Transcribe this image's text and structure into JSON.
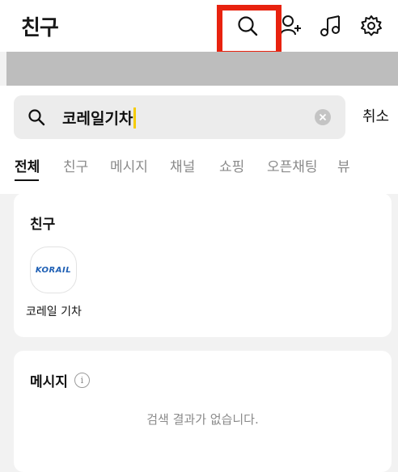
{
  "header": {
    "title": "친구",
    "icons": [
      "search-icon",
      "add-friend-icon",
      "music-icon",
      "gear-icon"
    ]
  },
  "search": {
    "value": "코레일기차",
    "cancel_label": "취소"
  },
  "tabs": [
    {
      "label": "전체",
      "active": true
    },
    {
      "label": "친구",
      "active": false
    },
    {
      "label": "메시지",
      "active": false
    },
    {
      "label": "채널",
      "active": false
    },
    {
      "label": "쇼핑",
      "active": false
    },
    {
      "label": "오픈채팅",
      "active": false
    },
    {
      "label": "뷰",
      "active": false
    }
  ],
  "friends_section": {
    "title": "친구",
    "items": [
      {
        "name": "코레일 기차",
        "logo_text": "KORAIL"
      }
    ]
  },
  "messages_section": {
    "title": "메시지",
    "empty_text": "검색 결과가 없습니다."
  },
  "colors": {
    "highlight": "#e8220f",
    "caret": "#f5cc00",
    "korail_blue": "#1e5fb4"
  }
}
